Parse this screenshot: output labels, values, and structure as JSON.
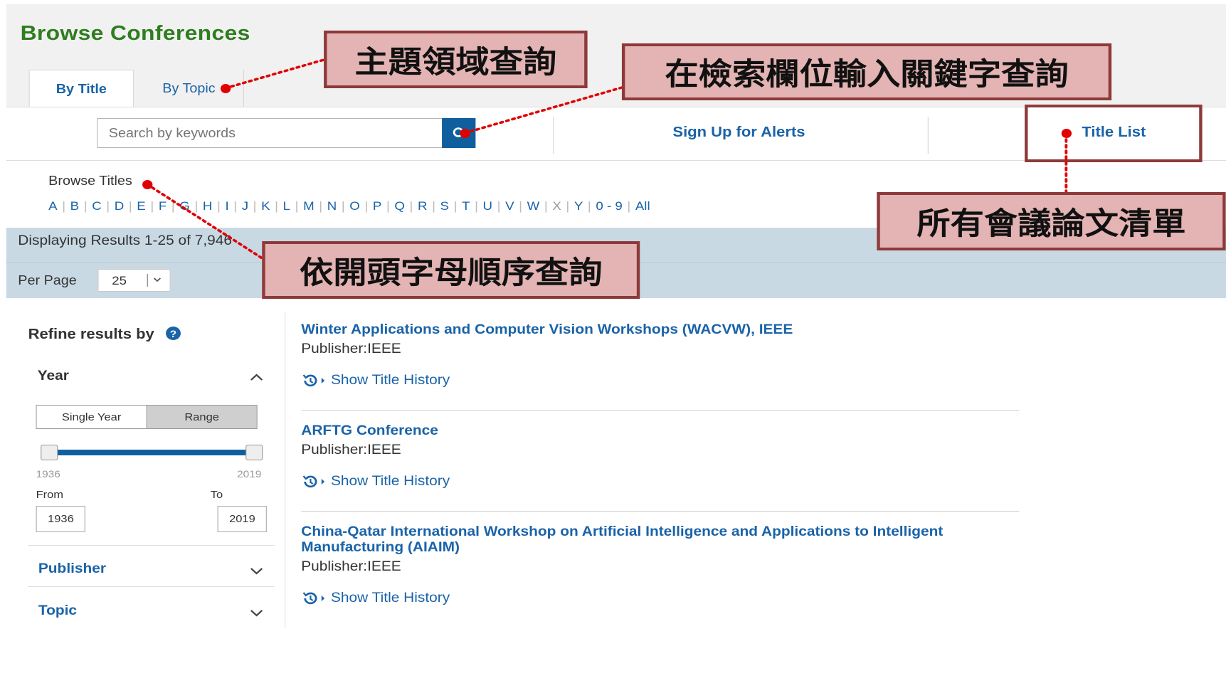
{
  "header": {
    "title": "Browse Conferences",
    "tabs": [
      {
        "label": "By Title",
        "active": true
      },
      {
        "label": "By Topic",
        "active": false
      }
    ]
  },
  "toolbar": {
    "search_placeholder": "Search by keywords",
    "search_button_icon": "search-icon",
    "alerts_label": "Sign Up for Alerts",
    "title_list_label": "Title List"
  },
  "browse": {
    "label": "Browse Titles",
    "letters": [
      "A",
      "B",
      "C",
      "D",
      "E",
      "F",
      "G",
      "H",
      "I",
      "J",
      "K",
      "L",
      "M",
      "N",
      "O",
      "P",
      "Q",
      "R",
      "S",
      "T",
      "U",
      "V",
      "W",
      "X",
      "Y",
      "0 - 9",
      "All"
    ],
    "disabled": [
      "X"
    ]
  },
  "results_bar": {
    "displaying": "Displaying Results 1-25 of 7,946",
    "per_page_label": "Per Page",
    "per_page_value": "25"
  },
  "sidebar": {
    "refine_label": "Refine results by",
    "year": {
      "label": "Year",
      "segments": [
        "Single Year",
        "Range"
      ],
      "selected_segment": "Range",
      "min": "1936",
      "max": "2019",
      "from_label": "From",
      "to_label": "To",
      "from_value": "1936",
      "to_value": "2019"
    },
    "facets": [
      "Publisher",
      "Topic"
    ]
  },
  "results": [
    {
      "title": "Winter Applications and Computer Vision Workshops (WACVW), IEEE",
      "publisher_label": "Publisher:",
      "publisher": "IEEE",
      "history_label": "Show Title History"
    },
    {
      "title": "ARFTG Conference",
      "publisher_label": "Publisher:",
      "publisher": "IEEE",
      "history_label": "Show Title History"
    },
    {
      "title": "China-Qatar International Workshop on Artificial Intelligence and Applications to Intelligent",
      "title_line2": "Manufacturing (AIAIM)",
      "publisher_label": "Publisher:",
      "publisher": "IEEE",
      "history_label": "Show Title History"
    }
  ],
  "annotations": {
    "topic": "主題領域查詢",
    "keyword": "在檢索欄位輸入關鍵字查詢",
    "title_list": "所有會議論文清單",
    "alphabet": "依開頭字母順序查詢"
  },
  "colors": {
    "brand_green": "#2e7d1f",
    "link_blue": "#1a63a8",
    "button_blue": "#0f5f9e",
    "callout_fill": "#e4b3b3",
    "callout_border": "#8d3a3a",
    "marker_red": "#e00000"
  }
}
